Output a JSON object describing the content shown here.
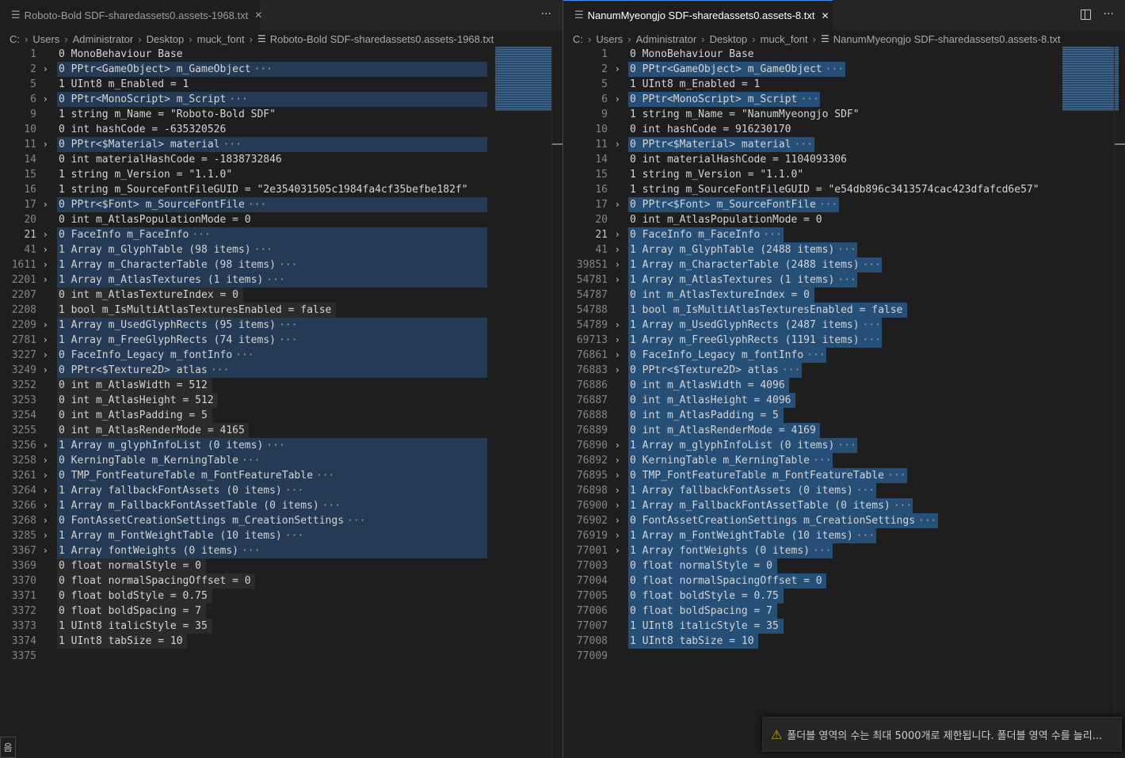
{
  "left": {
    "tab_title": "Roboto-Bold SDF-sharedassets0.assets-1968.txt",
    "tab_close": "✕",
    "more_actions": "···",
    "breadcrumb": [
      "C:",
      "Users",
      "Administrator",
      "Desktop",
      "muck_font",
      "Roboto-Bold SDF-sharedassets0.assets-1968.txt"
    ],
    "lines": [
      {
        "n": "1",
        "t": "0 MonoBehaviour Base",
        "fold": false,
        "hl": ""
      },
      {
        "n": "2",
        "t": "0 PPtr<GameObject> m_GameObject",
        "fold": true,
        "hl": "fold"
      },
      {
        "n": "5",
        "t": "1 UInt8 m_Enabled = 1",
        "fold": false,
        "hl": ""
      },
      {
        "n": "6",
        "t": "0 PPtr<MonoScript> m_Script",
        "fold": true,
        "hl": "fold"
      },
      {
        "n": "9",
        "t": "1 string m_Name = \"Roboto-Bold SDF\"",
        "fold": false,
        "hl": ""
      },
      {
        "n": "10",
        "t": "0 int hashCode = -635320526",
        "fold": false,
        "hl": ""
      },
      {
        "n": "11",
        "t": "0 PPtr<$Material> material",
        "fold": true,
        "hl": "fold"
      },
      {
        "n": "14",
        "t": "0 int materialHashCode = -1838732846",
        "fold": false,
        "hl": ""
      },
      {
        "n": "15",
        "t": "1 string m_Version = \"1.1.0\"",
        "fold": false,
        "hl": ""
      },
      {
        "n": "16",
        "t": "1 string m_SourceFontFileGUID = \"2e354031505c1984fa4cf35befbe182f\"",
        "fold": false,
        "hl": ""
      },
      {
        "n": "17",
        "t": "0 PPtr<$Font> m_SourceFontFile",
        "fold": true,
        "hl": "fold"
      },
      {
        "n": "20",
        "t": "0 int m_AtlasPopulationMode = 0",
        "fold": false,
        "hl": ""
      },
      {
        "n": "21",
        "t": "0 FaceInfo m_FaceInfo",
        "fold": true,
        "hl": "fold",
        "active": true
      },
      {
        "n": "41",
        "t": "1 Array m_GlyphTable (98 items)",
        "fold": true,
        "hl": "fold"
      },
      {
        "n": "1611",
        "t": "1 Array m_CharacterTable (98 items)",
        "fold": true,
        "hl": "fold"
      },
      {
        "n": "2201",
        "t": "1 Array m_AtlasTextures (1 items)",
        "fold": true,
        "hl": "fold"
      },
      {
        "n": "2207",
        "t": "0 int m_AtlasTextureIndex = 0",
        "fold": false,
        "hl": "sel"
      },
      {
        "n": "2208",
        "t": "1 bool m_IsMultiAtlasTexturesEnabled = false",
        "fold": false,
        "hl": "sel"
      },
      {
        "n": "2209",
        "t": "1 Array m_UsedGlyphRects (95 items)",
        "fold": true,
        "hl": "fold"
      },
      {
        "n": "2781",
        "t": "1 Array m_FreeGlyphRects (74 items)",
        "fold": true,
        "hl": "fold"
      },
      {
        "n": "3227",
        "t": "0 FaceInfo_Legacy m_fontInfo",
        "fold": true,
        "hl": "fold"
      },
      {
        "n": "3249",
        "t": "0 PPtr<$Texture2D> atlas",
        "fold": true,
        "hl": "fold"
      },
      {
        "n": "3252",
        "t": "0 int m_AtlasWidth = 512",
        "fold": false,
        "hl": "sel"
      },
      {
        "n": "3253",
        "t": "0 int m_AtlasHeight = 512",
        "fold": false,
        "hl": "sel"
      },
      {
        "n": "3254",
        "t": "0 int m_AtlasPadding = 5",
        "fold": false,
        "hl": "sel"
      },
      {
        "n": "3255",
        "t": "0 int m_AtlasRenderMode = 4165",
        "fold": false,
        "hl": "sel"
      },
      {
        "n": "3256",
        "t": "1 Array m_glyphInfoList (0 items)",
        "fold": true,
        "hl": "fold"
      },
      {
        "n": "3258",
        "t": "0 KerningTable m_KerningTable",
        "fold": true,
        "hl": "fold"
      },
      {
        "n": "3261",
        "t": "0 TMP_FontFeatureTable m_FontFeatureTable",
        "fold": true,
        "hl": "fold"
      },
      {
        "n": "3264",
        "t": "1 Array fallbackFontAssets (0 items)",
        "fold": true,
        "hl": "fold"
      },
      {
        "n": "3266",
        "t": "1 Array m_FallbackFontAssetTable (0 items)",
        "fold": true,
        "hl": "fold"
      },
      {
        "n": "3268",
        "t": "0 FontAssetCreationSettings m_CreationSettings",
        "fold": true,
        "hl": "fold"
      },
      {
        "n": "3285",
        "t": "1 Array m_FontWeightTable (10 items)",
        "fold": true,
        "hl": "fold"
      },
      {
        "n": "3367",
        "t": "1 Array fontWeights (0 items)",
        "fold": true,
        "hl": "fold"
      },
      {
        "n": "3369",
        "t": "0 float normalStyle = 0",
        "fold": false,
        "hl": "sel"
      },
      {
        "n": "3370",
        "t": "0 float normalSpacingOffset = 0",
        "fold": false,
        "hl": "sel"
      },
      {
        "n": "3371",
        "t": "0 float boldStyle = 0.75",
        "fold": false,
        "hl": "sel"
      },
      {
        "n": "3372",
        "t": "0 float boldSpacing = 7",
        "fold": false,
        "hl": "sel"
      },
      {
        "n": "3373",
        "t": "1 UInt8 italicStyle = 35",
        "fold": false,
        "hl": "sel"
      },
      {
        "n": "3374",
        "t": "1 UInt8 tabSize = 10",
        "fold": false,
        "hl": "sel"
      },
      {
        "n": "3375",
        "t": "",
        "fold": false,
        "hl": ""
      }
    ]
  },
  "right": {
    "tab_title": "NanumMyeongjo SDF-sharedassets0.assets-8.txt",
    "tab_close": "✕",
    "more_actions": "···",
    "breadcrumb": [
      "C:",
      "Users",
      "Administrator",
      "Desktop",
      "muck_font",
      "NanumMyeongjo SDF-sharedassets0.assets-8.txt"
    ],
    "lines": [
      {
        "n": "1",
        "t": "0 MonoBehaviour Base",
        "fold": false,
        "hl": ""
      },
      {
        "n": "2",
        "t": "0 PPtr<GameObject> m_GameObject",
        "fold": true,
        "hl": "fold"
      },
      {
        "n": "5",
        "t": "1 UInt8 m_Enabled = 1",
        "fold": false,
        "hl": ""
      },
      {
        "n": "6",
        "t": "0 PPtr<MonoScript> m_Script",
        "fold": true,
        "hl": "fold"
      },
      {
        "n": "9",
        "t": "1 string m_Name = \"NanumMyeongjo SDF\"",
        "fold": false,
        "hl": ""
      },
      {
        "n": "10",
        "t": "0 int hashCode = 916230170",
        "fold": false,
        "hl": ""
      },
      {
        "n": "11",
        "t": "0 PPtr<$Material> material",
        "fold": true,
        "hl": "fold"
      },
      {
        "n": "14",
        "t": "0 int materialHashCode = 1104093306",
        "fold": false,
        "hl": ""
      },
      {
        "n": "15",
        "t": "1 string m_Version = \"1.1.0\"",
        "fold": false,
        "hl": ""
      },
      {
        "n": "16",
        "t": "1 string m_SourceFontFileGUID = \"e54db896c3413574cac423dfafcd6e57\"",
        "fold": false,
        "hl": ""
      },
      {
        "n": "17",
        "t": "0 PPtr<$Font> m_SourceFontFile",
        "fold": true,
        "hl": "fold"
      },
      {
        "n": "20",
        "t": "0 int m_AtlasPopulationMode = 0",
        "fold": false,
        "hl": ""
      },
      {
        "n": "21",
        "t": "0 FaceInfo m_FaceInfo",
        "fold": true,
        "hl": "fold",
        "active": true
      },
      {
        "n": "41",
        "t": "1 Array m_GlyphTable (2488 items)",
        "fold": true,
        "hl": "sel"
      },
      {
        "n": "39851",
        "t": "1 Array m_CharacterTable (2488 items)",
        "fold": true,
        "hl": "sel"
      },
      {
        "n": "54781",
        "t": "1 Array m_AtlasTextures (1 items)",
        "fold": true,
        "hl": "sel"
      },
      {
        "n": "54787",
        "t": "0 int m_AtlasTextureIndex = 0",
        "fold": false,
        "hl": "sel"
      },
      {
        "n": "54788",
        "t": "1 bool m_IsMultiAtlasTexturesEnabled = false",
        "fold": false,
        "hl": "sel"
      },
      {
        "n": "54789",
        "t": "1 Array m_UsedGlyphRects (2487 items)",
        "fold": true,
        "hl": "sel"
      },
      {
        "n": "69713",
        "t": "1 Array m_FreeGlyphRects (1191 items)",
        "fold": true,
        "hl": "sel"
      },
      {
        "n": "76861",
        "t": "0 FaceInfo_Legacy m_fontInfo",
        "fold": true,
        "hl": "sel"
      },
      {
        "n": "76883",
        "t": "0 PPtr<$Texture2D> atlas",
        "fold": true,
        "hl": "sel"
      },
      {
        "n": "76886",
        "t": "0 int m_AtlasWidth = 4096",
        "fold": false,
        "hl": "sel"
      },
      {
        "n": "76887",
        "t": "0 int m_AtlasHeight = 4096",
        "fold": false,
        "hl": "sel"
      },
      {
        "n": "76888",
        "t": "0 int m_AtlasPadding = 5",
        "fold": false,
        "hl": "sel"
      },
      {
        "n": "76889",
        "t": "0 int m_AtlasRenderMode = 4169",
        "fold": false,
        "hl": "sel"
      },
      {
        "n": "76890",
        "t": "1 Array m_glyphInfoList (0 items)",
        "fold": true,
        "hl": "sel"
      },
      {
        "n": "76892",
        "t": "0 KerningTable m_KerningTable",
        "fold": true,
        "hl": "sel"
      },
      {
        "n": "76895",
        "t": "0 TMP_FontFeatureTable m_FontFeatureTable",
        "fold": true,
        "hl": "sel"
      },
      {
        "n": "76898",
        "t": "1 Array fallbackFontAssets (0 items)",
        "fold": true,
        "hl": "sel"
      },
      {
        "n": "76900",
        "t": "1 Array m_FallbackFontAssetTable (0 items)",
        "fold": true,
        "hl": "sel"
      },
      {
        "n": "76902",
        "t": "0 FontAssetCreationSettings m_CreationSettings",
        "fold": true,
        "hl": "sel"
      },
      {
        "n": "76919",
        "t": "1 Array m_FontWeightTable (10 items)",
        "fold": true,
        "hl": "sel"
      },
      {
        "n": "77001",
        "t": "1 Array fontWeights (0 items)",
        "fold": true,
        "hl": "sel"
      },
      {
        "n": "77003",
        "t": "0 float normalStyle = 0",
        "fold": false,
        "hl": "sel"
      },
      {
        "n": "77004",
        "t": "0 float normalSpacingOffset = 0",
        "fold": false,
        "hl": "sel"
      },
      {
        "n": "77005",
        "t": "0 float boldStyle = 0.75",
        "fold": false,
        "hl": "sel"
      },
      {
        "n": "77006",
        "t": "0 float boldSpacing = 7",
        "fold": false,
        "hl": "sel"
      },
      {
        "n": "77007",
        "t": "1 UInt8 italicStyle = 35",
        "fold": false,
        "hl": "sel"
      },
      {
        "n": "77008",
        "t": "1 UInt8 tabSize = 10",
        "fold": false,
        "hl": "sel"
      },
      {
        "n": "77009",
        "t": "",
        "fold": false,
        "hl": ""
      }
    ]
  },
  "notification": {
    "icon": "warning-icon",
    "text": "폴더블 영역의 수는 최대 5000개로 제한됩니다. 폴더블 영역 수를 늘리..."
  },
  "status_chip": "음",
  "colors": {
    "editor_bg": "#1e1e1e",
    "fold_highlight": "#264f78",
    "accent": "#3794ff",
    "warning": "#cca700"
  }
}
